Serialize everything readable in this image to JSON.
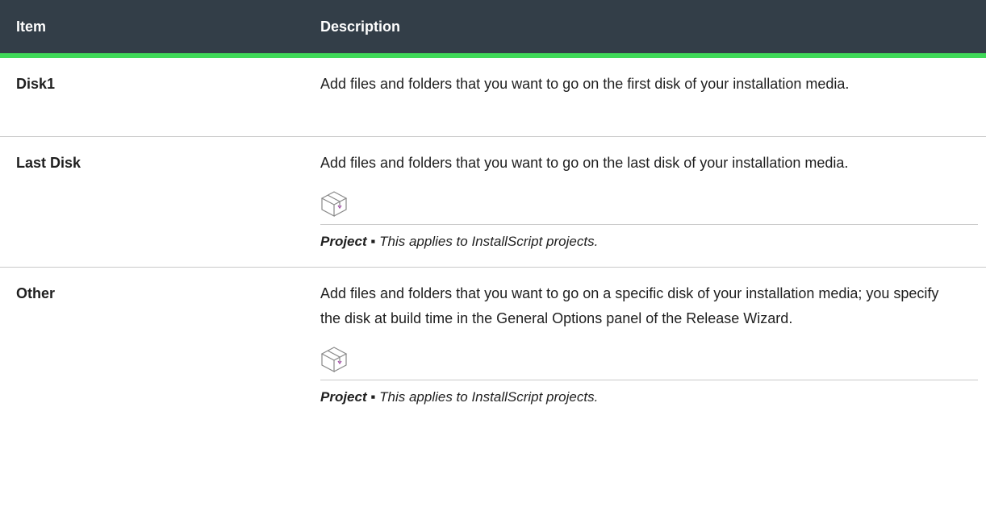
{
  "table": {
    "headers": {
      "item": "Item",
      "description": "Description"
    },
    "rows": [
      {
        "item": "Disk1",
        "description": "Add files and folders that you want to go on the first disk of your installation media."
      },
      {
        "item": "Last Disk",
        "description": "Add files and folders that you want to go on the last disk of your installation media.",
        "note_icon": "project-box-icon",
        "note_label": "Project",
        "note_separator": " ▪ ",
        "note_text": "This applies to InstallScript projects."
      },
      {
        "item": "Other",
        "description": "Add files and folders that you want to go on a specific disk of your installation media; you specify the disk at build time in the General Options panel of the Release Wizard.",
        "note_icon": "project-box-icon",
        "note_label": "Project",
        "note_separator": " ▪ ",
        "note_text": "This applies to InstallScript projects."
      }
    ]
  },
  "colors": {
    "header_bg": "#333e48",
    "header_accent": "#3fd958",
    "icon_accent": "#a54aa8"
  }
}
